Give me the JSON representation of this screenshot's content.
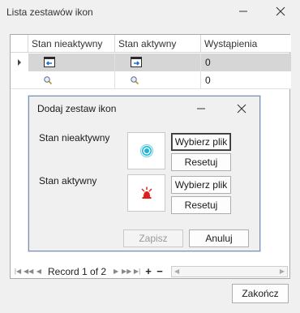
{
  "window": {
    "title": "Lista zestawów ikon"
  },
  "grid": {
    "columns": [
      "Stan nieaktywny",
      "Stan aktywny",
      "Wystąpienia"
    ],
    "rows": [
      {
        "occurrences": "0",
        "inactive_icon": "window-back-arrow-icon",
        "active_icon": "window-forward-arrow-icon"
      },
      {
        "occurrences": "0",
        "inactive_icon": "magnifier-icon",
        "active_icon": "magnifier-icon"
      }
    ],
    "navigator": {
      "record_text": "Record 1 of 2",
      "add": "+",
      "remove": "−"
    }
  },
  "dialog": {
    "title": "Dodaj zestaw ikon",
    "inactive_label": "Stan nieaktywny",
    "active_label": "Stan aktywny",
    "pick_file": "Wybierz plik",
    "reset": "Resetuj",
    "save": "Zapisz",
    "cancel": "Anuluj",
    "inactive_preview_icon": "cyan-circle-icon",
    "active_preview_icon": "red-indicator-icon"
  },
  "footer": {
    "close_label": "Zakończ"
  },
  "colors": {
    "selected_row": "#d6d6d6",
    "dialog_border": "#7a8fb4",
    "cyan_icon": "#1ab6d8",
    "red_icon": "#e01d1d"
  }
}
